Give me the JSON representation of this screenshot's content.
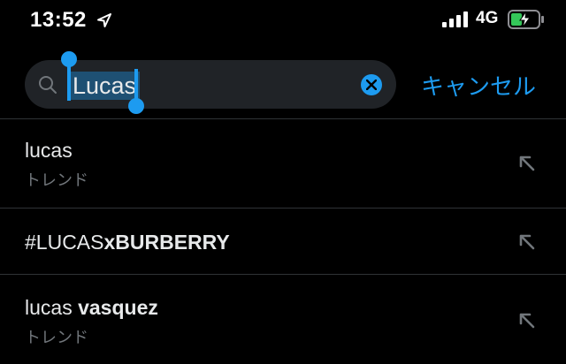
{
  "status_bar": {
    "time": "13:52",
    "network": "4G"
  },
  "search": {
    "query": "Lucas",
    "cancel_label": "キャンセル"
  },
  "suggestions": [
    {
      "title_prefix": "lucas",
      "title_rest": "",
      "subtitle": "トレンド"
    },
    {
      "title_prefix": "#LUCAS",
      "title_rest": "xBURBERRY",
      "subtitle": ""
    },
    {
      "title_prefix": "lucas ",
      "title_rest": "vasquez",
      "subtitle": "トレンド"
    }
  ],
  "colors": {
    "background": "#000000",
    "accent": "#1d9bf0",
    "search_bg": "#202327",
    "secondary_text": "#71767b"
  }
}
